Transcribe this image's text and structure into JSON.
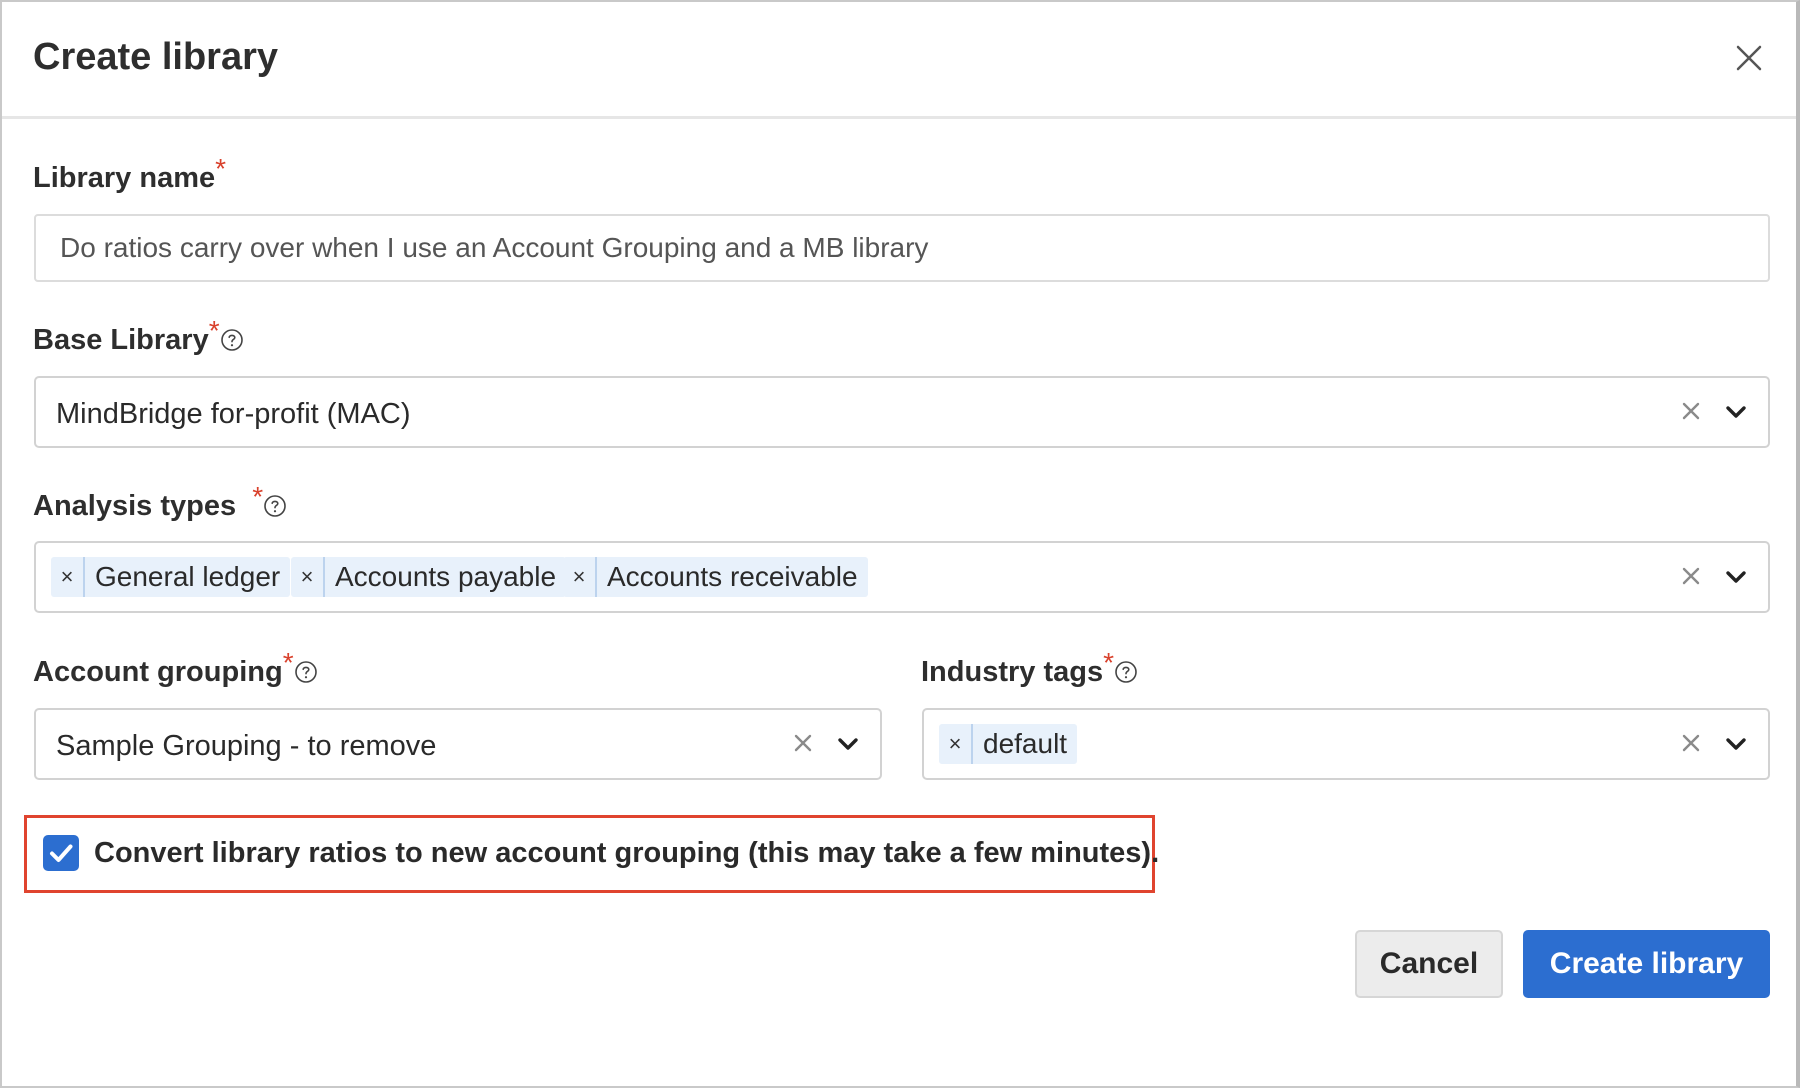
{
  "dialog": {
    "title": "Create library"
  },
  "fields": {
    "library_name": {
      "label": "Library name",
      "required_mark": "*",
      "value": "Do ratios carry over when I use an Account Grouping and a MB library"
    },
    "base_library": {
      "label": "Base Library",
      "required_mark": "*",
      "value": "MindBridge for-profit (MAC)"
    },
    "analysis_types": {
      "label": "Analysis types",
      "required_mark": "*",
      "selected": [
        "General ledger",
        "Accounts payable",
        "Accounts receivable"
      ]
    },
    "account_grouping": {
      "label": "Account grouping",
      "required_mark": "*",
      "value": "Sample Grouping - to remove"
    },
    "industry_tags": {
      "label": "Industry tags",
      "required_mark": "*",
      "selected": [
        "default"
      ]
    }
  },
  "convert_option": {
    "checked": true,
    "label": "Convert library ratios to new account grouping (this may take a few minutes)."
  },
  "buttons": {
    "cancel": "Cancel",
    "create": "Create library"
  },
  "colors": {
    "primary": "#2c6ed0",
    "required": "#d9412c",
    "highlight": "#e0442f",
    "chip_bg": "#e8f1fb"
  },
  "icons": {
    "close": "close-icon",
    "help": "help-circle-icon",
    "clear": "clear-icon",
    "dropdown": "chevron-down-icon",
    "check": "checkmark-icon"
  }
}
